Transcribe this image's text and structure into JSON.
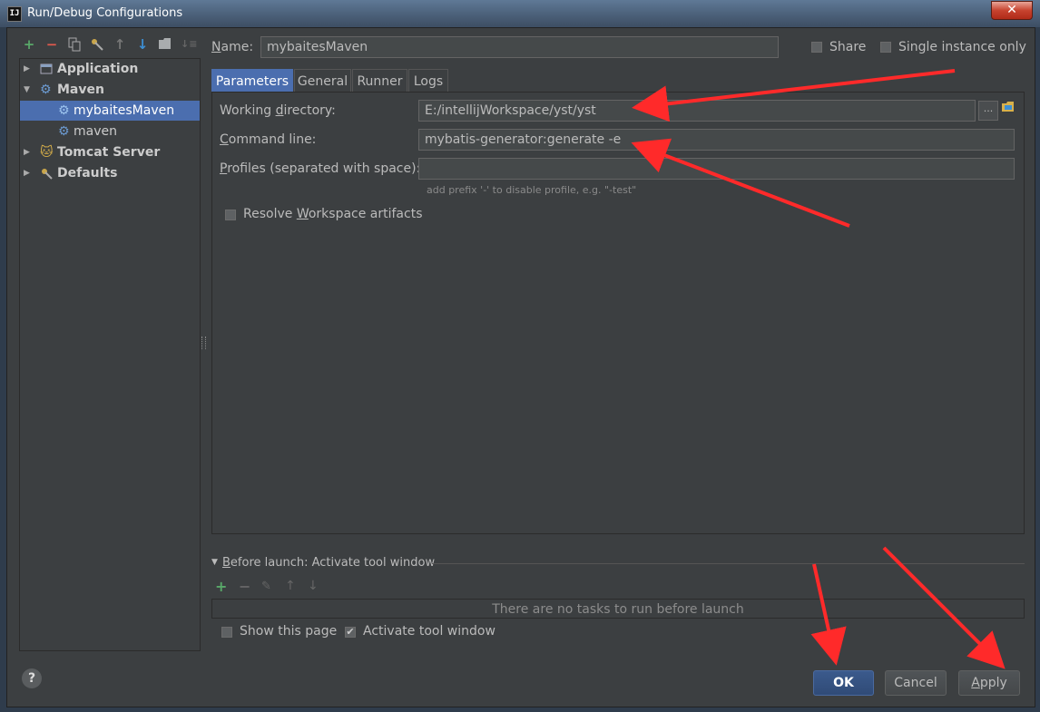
{
  "window": {
    "title": "Run/Debug Configurations",
    "app_icon": "IJ",
    "close_glyph": "✕"
  },
  "toolbar": {
    "icons": [
      "add-icon",
      "remove-icon",
      "copy-icon",
      "wrench-icon",
      "move-up-icon",
      "move-down-icon",
      "folder-icon",
      "sort-icon"
    ]
  },
  "tree": {
    "items": [
      {
        "label": "Application",
        "icon": "application-icon"
      },
      {
        "label": "Maven",
        "icon": "maven-icon"
      },
      {
        "label": "mybaitesMaven",
        "icon": "maven-config-icon",
        "selected": true
      },
      {
        "label": "maven",
        "icon": "maven-config-icon"
      },
      {
        "label": "Tomcat Server",
        "icon": "tomcat-icon"
      },
      {
        "label": "Defaults",
        "icon": "defaults-icon"
      }
    ]
  },
  "config": {
    "name_label": "Name:",
    "name_value": "mybaitesMaven",
    "share_label": "Share",
    "single_instance_label": "Single instance only"
  },
  "tabs": [
    {
      "label": "Parameters",
      "active": true
    },
    {
      "label": "General"
    },
    {
      "label": "Runner"
    },
    {
      "label": "Logs"
    }
  ],
  "parameters": {
    "working_dir_label": "Working directory:",
    "working_dir_value": "E:/intellijWorkspace/yst/yst",
    "browse_label": "...",
    "command_line_label": "Command line:",
    "command_line_value": "mybatis-generator:generate -e",
    "profiles_label": "Profiles (separated with space):",
    "profiles_value": "",
    "profiles_hint": "add prefix '-' to disable profile, e.g. \"-test\"",
    "resolve_label": "Resolve Workspace artifacts"
  },
  "before_launch": {
    "title": "Before launch: Activate tool window",
    "empty_text": "There are no tasks to run before launch",
    "show_page_label": "Show this page",
    "activate_label": "Activate tool window",
    "activate_checked": true
  },
  "buttons": {
    "ok": "OK",
    "cancel": "Cancel",
    "apply": "Apply",
    "help": "?"
  },
  "colors": {
    "accent": "#4b6eaf",
    "annotation_arrow": "#ff2a2a",
    "background": "#3c3f41"
  }
}
